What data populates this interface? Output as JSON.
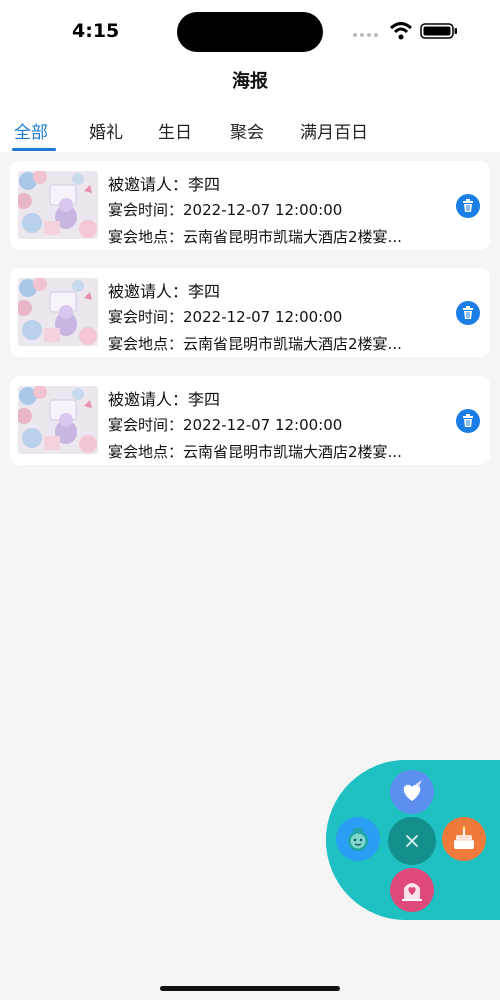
{
  "status_bar": {
    "time": "4:15"
  },
  "header": {
    "title": "海报"
  },
  "tabs": [
    {
      "label": "全部",
      "active": true
    },
    {
      "label": "婚礼",
      "active": false
    },
    {
      "label": "生日",
      "active": false
    },
    {
      "label": "聚会",
      "active": false
    },
    {
      "label": "满月百日",
      "active": false
    }
  ],
  "cards": [
    {
      "invitee_label": "被邀请人：",
      "invitee": "李四",
      "time_label": "宴会时间：",
      "time": "2022-12-07 12:00:00",
      "place_label": "宴会地点：",
      "place": "云南省昆明市凯瑞大酒店2楼宴..."
    },
    {
      "invitee_label": "被邀请人：",
      "invitee": "李四",
      "time_label": "宴会时间：",
      "time": "2022-12-07 12:00:00",
      "place_label": "宴会地点：",
      "place": "云南省昆明市凯瑞大酒店2楼宴..."
    },
    {
      "invitee_label": "被邀请人：",
      "invitee": "李四",
      "time_label": "宴会时间：",
      "time": "2022-12-07 12:00:00",
      "place_label": "宴会地点：",
      "place": "云南省昆明市凯瑞大酒店2楼宴..."
    }
  ],
  "fab_menu": {
    "items": [
      {
        "icon": "heart-feather-icon",
        "color": "#5c8ff0"
      },
      {
        "icon": "baby-face-icon",
        "color": "#2a9df4"
      },
      {
        "icon": "close-icon",
        "color": "#14908c"
      },
      {
        "icon": "cake-icon",
        "color": "#f07a3c"
      },
      {
        "icon": "wedding-arch-icon",
        "color": "#e04a7a"
      }
    ],
    "wheel_color": "#1ec0c1"
  },
  "colors": {
    "accent": "#1e7ad3",
    "background": "#f5f5f5",
    "delete": "#1a7ee6"
  }
}
